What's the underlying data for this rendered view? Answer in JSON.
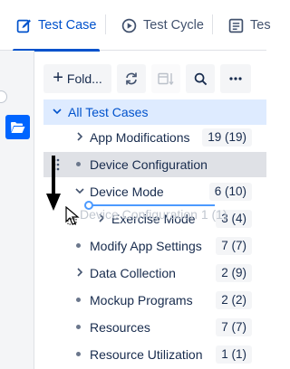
{
  "tabs": [
    {
      "label": "Test Case",
      "icon": "edit-icon",
      "active": true
    },
    {
      "label": "Test Cycle",
      "icon": "play-cycle-icon",
      "active": false
    },
    {
      "label": "Tes",
      "icon": "list-doc-icon",
      "active": false
    }
  ],
  "toolbar": {
    "new_folder_label": "Fold...",
    "icons": [
      "refresh-icon",
      "calendar-sort-icon",
      "search-icon",
      "more-icon"
    ]
  },
  "tree": {
    "root": {
      "label": "All Test Cases"
    },
    "items": [
      {
        "label": "App Modifications",
        "count": "19 (19)",
        "type": "folder-collapsed"
      },
      {
        "label": "Device Configuration",
        "count": "",
        "type": "leaf-dragging"
      },
      {
        "label": "Device Mode",
        "count": "6 (10)",
        "type": "folder-expanded"
      },
      {
        "label": "Exercise Mode",
        "count": "3 (4)",
        "type": "child-folder-collapsed"
      },
      {
        "label": "Modify App Settings",
        "count": "7 (7)",
        "type": "leaf"
      },
      {
        "label": "Data Collection",
        "count": "2 (9)",
        "type": "folder-collapsed"
      },
      {
        "label": "Mockup Programs",
        "count": "2 (2)",
        "type": "leaf"
      },
      {
        "label": "Resources",
        "count": "7 (7)",
        "type": "leaf"
      },
      {
        "label": "Resource Utilization",
        "count": "1 (1)",
        "type": "leaf"
      }
    ],
    "drag_ghost": "Device Configuration  1 (1)"
  },
  "colors": {
    "accent": "#0052cc",
    "selected_bg": "#deebff",
    "drop_indicator": "#4c9aff"
  }
}
